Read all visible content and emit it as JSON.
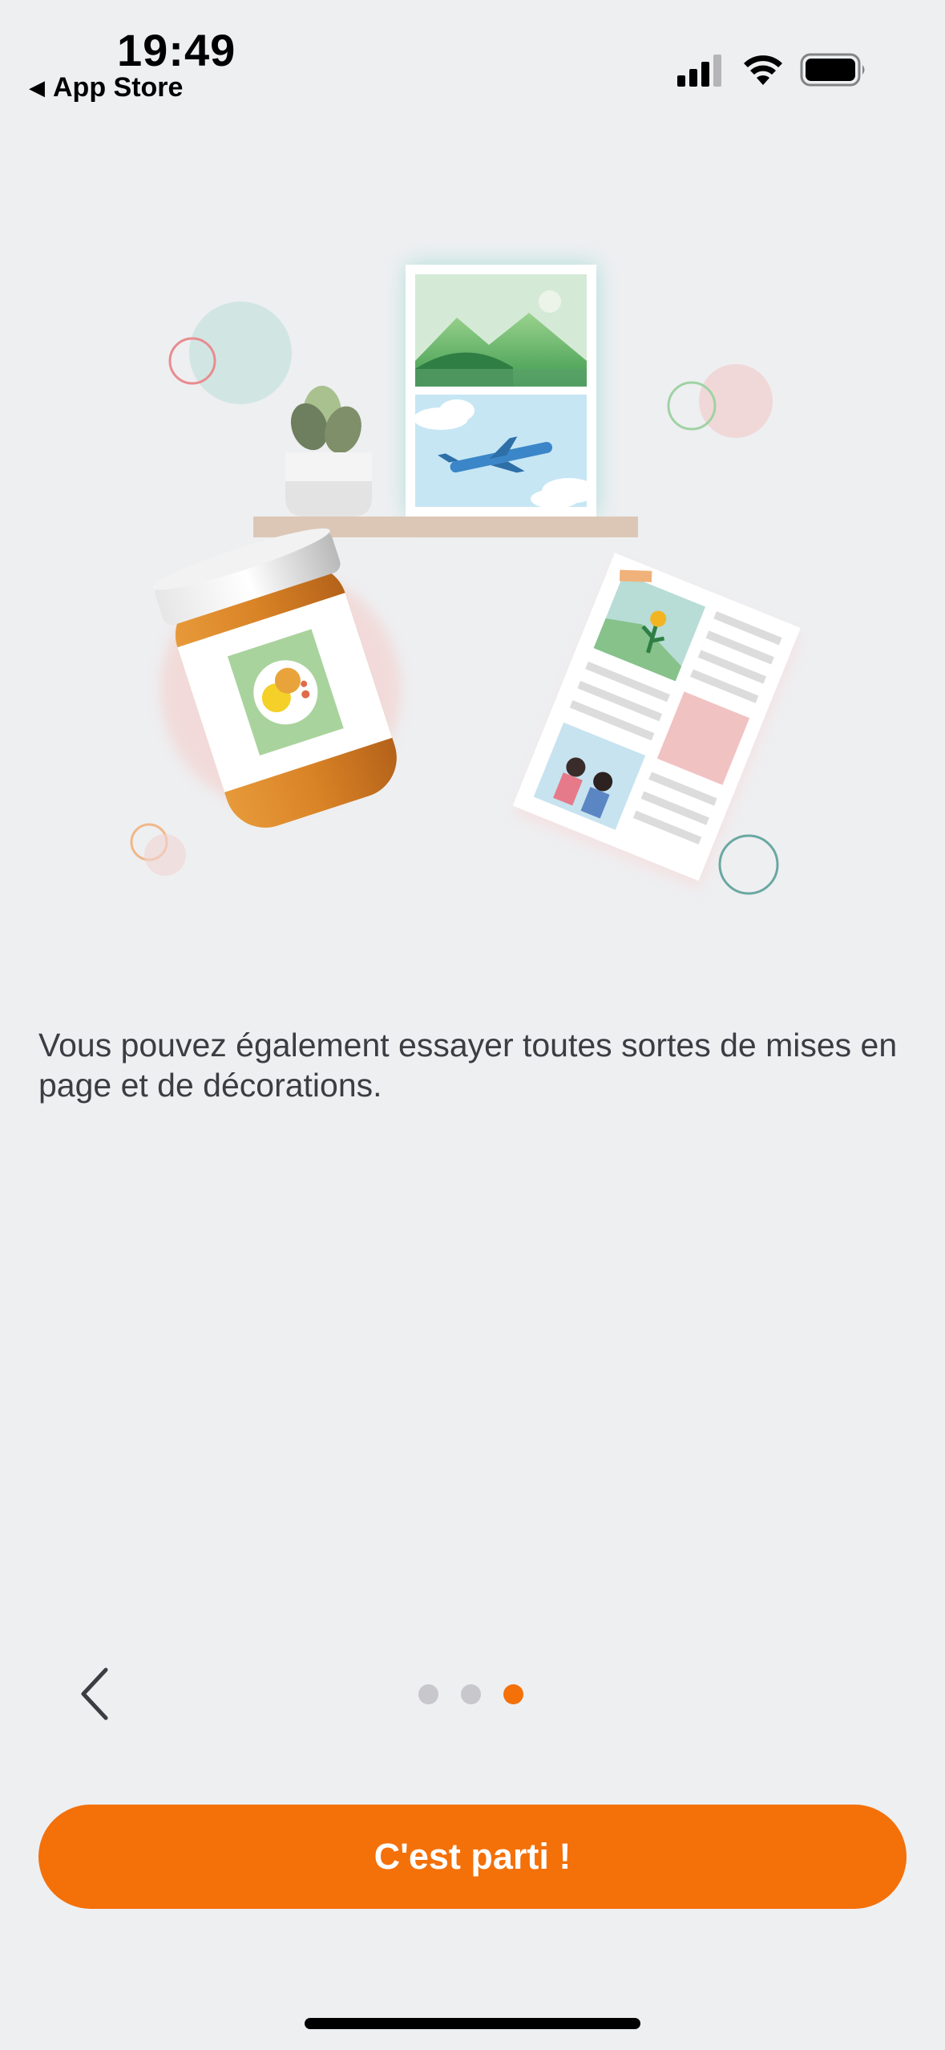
{
  "status_bar": {
    "time": "19:49",
    "back_label": "App Store",
    "icons": [
      "cellular-signal-icon",
      "wifi-icon",
      "battery-icon"
    ]
  },
  "onboarding": {
    "illustration": "photo-products-illustration",
    "description": "Vous pouvez également essayer toutes sortes de mises en page et de décorations.",
    "page_indicator": {
      "total": 3,
      "current": 3
    },
    "cta_label": "C'est parti !",
    "prev_icon": "chevron-left-icon"
  },
  "colors": {
    "accent": "#f47009",
    "background": "#eeeff1",
    "text": "#3c3c43",
    "dot_inactive": "#c7c7cc",
    "dot_active": "#f47009"
  }
}
